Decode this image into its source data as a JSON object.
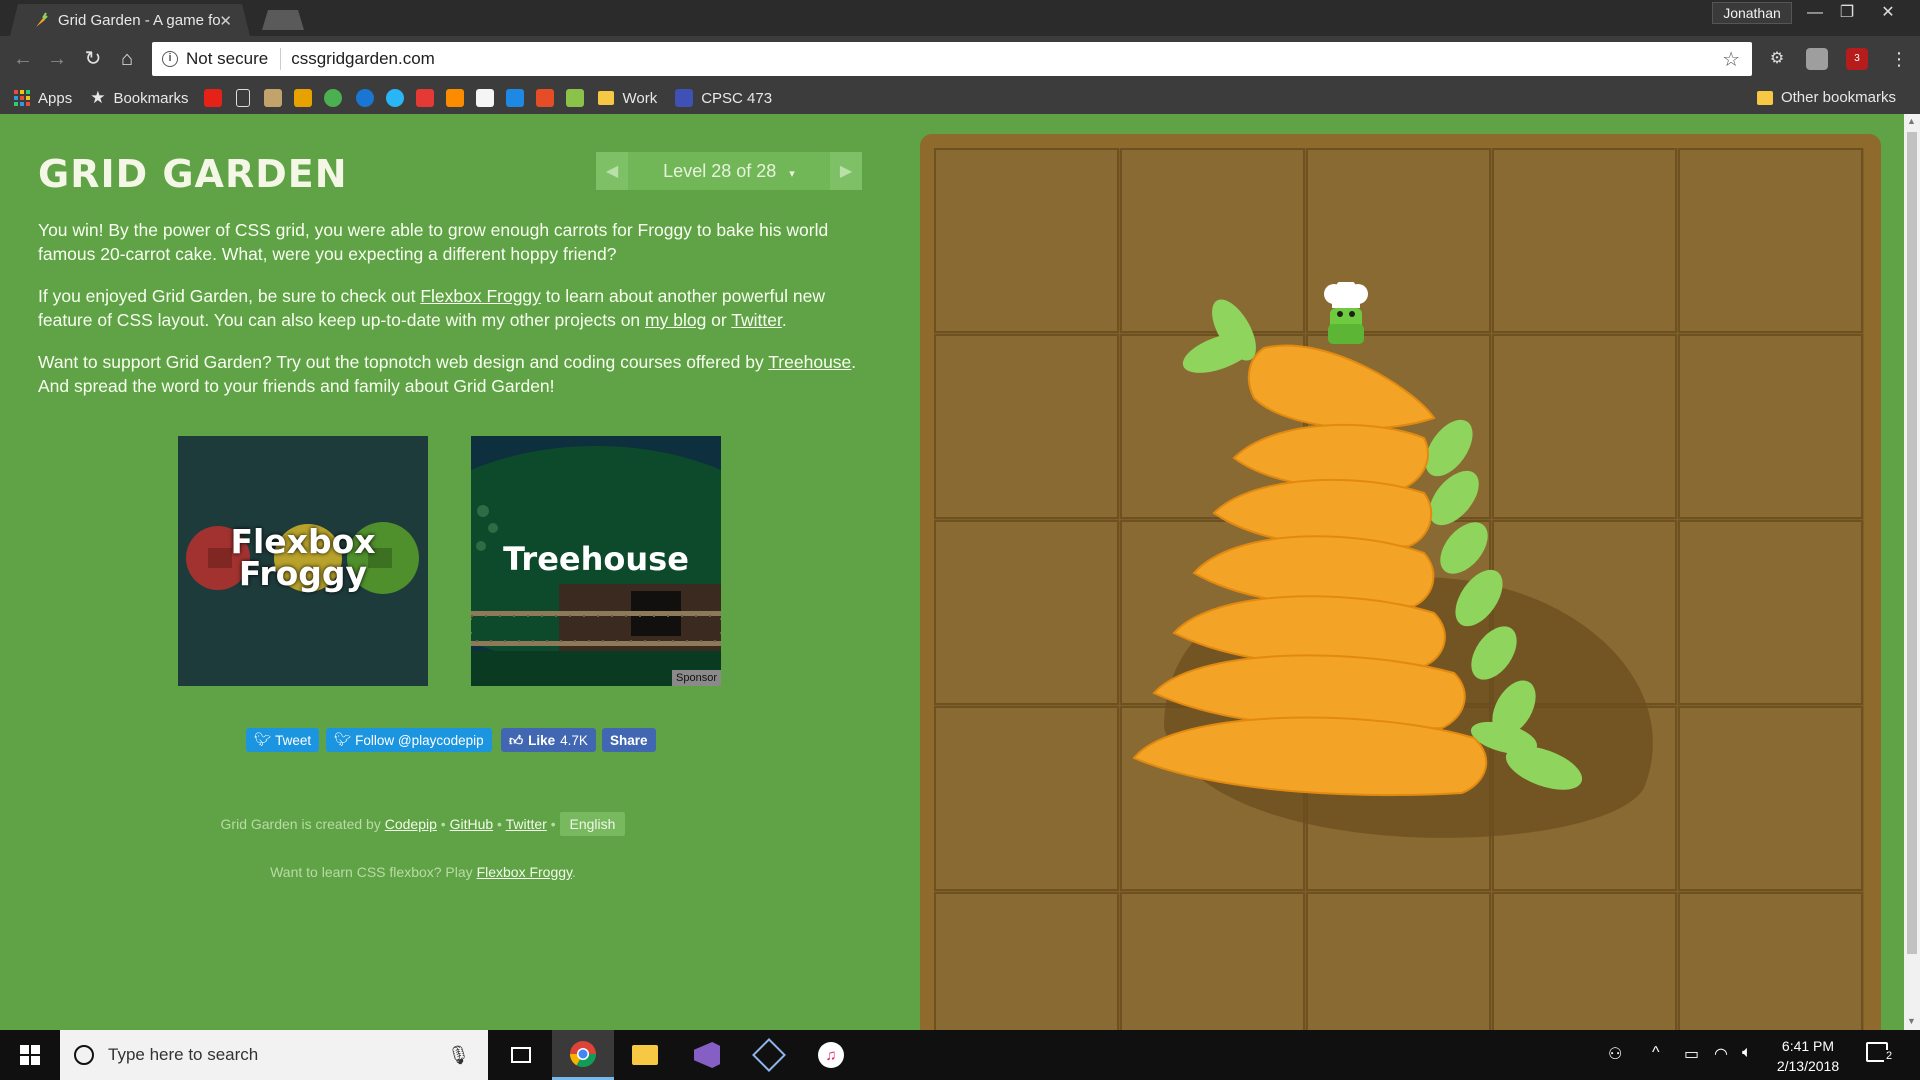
{
  "browser": {
    "tab_title": "Grid Garden - A game fo",
    "profile_name": "Jonathan",
    "security_label": "Not secure",
    "url": "cssgridgarden.com",
    "extension_badge": "3"
  },
  "bookmarks": {
    "apps_label": "Apps",
    "bookmarks_label": "Bookmarks",
    "work_label": "Work",
    "cpsc_label": "CPSC 473",
    "other_label": "Other bookmarks"
  },
  "game": {
    "title": "GRID GARDEN",
    "level_label": "Level 28 of 28",
    "level_dropdown_icon": "▾",
    "win_text": "You win! By the power of CSS grid, you were able to grow enough carrots for Froggy to bake his world famous 20-carrot cake. What, were you expecting a different hoppy friend?",
    "p2_part1": "If you enjoyed Grid Garden, be sure to check out ",
    "p2_link_froggy": "Flexbox Froggy",
    "p2_part2": " to learn about another powerful new feature of CSS layout. You can also keep up-to-date with my other projects on ",
    "p2_link_blog": "my blog",
    "p2_part3": " or ",
    "p2_link_twitter": "Twitter",
    "p2_part4": ".",
    "p3_part1": "Want to support Grid Garden? Try out the topnotch web design and coding courses offered by ",
    "p3_link_treehouse": "Treehouse",
    "p3_part2": ". And spread the word to your friends and family about Grid Garden!",
    "promo_froggy_line1": "Flexbox",
    "promo_froggy_line2": "Froggy",
    "promo_treehouse": "Treehouse",
    "sponsor_label": "Sponsor"
  },
  "social": {
    "tweet_label": "Tweet",
    "follow_label": "Follow @playcodepip",
    "like_label": "Like",
    "like_count": "4.7K",
    "share_label": "Share"
  },
  "footer": {
    "created_by": "Grid Garden is created by ",
    "codepip": "Codepip",
    "sep": " • ",
    "github": "GitHub",
    "twitter": "Twitter",
    "language": "English",
    "flexbox_prefix": "Want to learn CSS flexbox? Play ",
    "flexbox_link": "Flexbox Froggy",
    "flexbox_suffix": "."
  },
  "taskbar": {
    "search_placeholder": "Type here to search",
    "time": "6:41 PM",
    "date": "2/13/2018",
    "notification_count": "2"
  },
  "colors": {
    "page_bg": "#5fa346",
    "soil": "#7f6029",
    "carrot": "#f3a325",
    "leaf": "#8fd45c",
    "frog": "#6ecb3f"
  }
}
